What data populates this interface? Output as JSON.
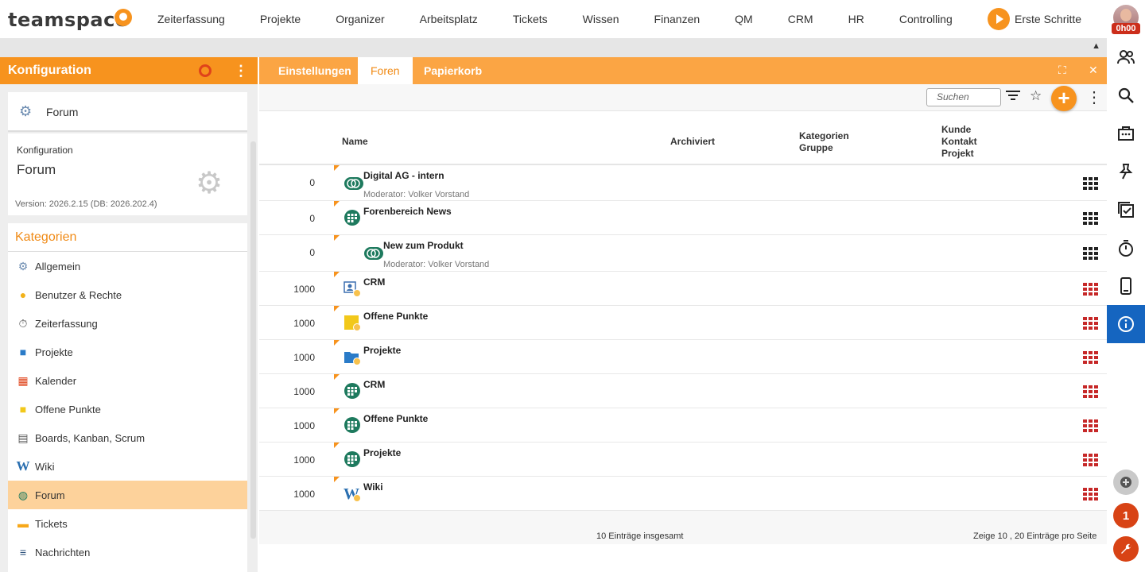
{
  "app": {
    "logo_text": "teamspace",
    "nav": [
      "Zeiterfassung",
      "Projekte",
      "Organizer",
      "Arbeitsplatz",
      "Tickets",
      "Wissen",
      "Finanzen",
      "QM",
      "CRM",
      "HR",
      "Controlling"
    ],
    "erste_schritte": "Erste Schritte",
    "time_badge": "0h00",
    "collapse_glyph": "▲"
  },
  "left": {
    "header_title": "Konfiguration",
    "menu_glyph": "⋮",
    "forum_card_label": "Forum",
    "info_small": "Konfiguration",
    "info_big": "Forum",
    "version": "Version: 2026.2.15 (DB: 2026.202.4)",
    "categories_title": "Kategorien",
    "categories": [
      {
        "label": "Allgemein",
        "icon": "⚙",
        "color": "#6b8bb0"
      },
      {
        "label": "Benutzer & Rechte",
        "icon": "●",
        "color": "#f2b21a"
      },
      {
        "label": "Zeiterfassung",
        "icon": "⏱",
        "color": "#555555"
      },
      {
        "label": "Projekte",
        "icon": "■",
        "color": "#2a7bc8"
      },
      {
        "label": "Kalender",
        "icon": "▦",
        "color": "#e0431a"
      },
      {
        "label": "Offene Punkte",
        "icon": "■",
        "color": "#f2c81a"
      },
      {
        "label": "Boards, Kanban, Scrum",
        "icon": "▤",
        "color": "#555555"
      },
      {
        "label": "Wiki",
        "icon": "W",
        "color": "#2a6fb0"
      },
      {
        "label": "Forum",
        "icon": "◍",
        "color": "#1e7a5e"
      },
      {
        "label": "Tickets",
        "icon": "▬",
        "color": "#f7a81a"
      },
      {
        "label": "Nachrichten",
        "icon": "≡",
        "color": "#2a4f7a"
      }
    ],
    "selected_category": "Forum"
  },
  "main": {
    "tabs": [
      "Einstellungen",
      "Foren",
      "Papierkorb"
    ],
    "active_tab": "Foren",
    "search_placeholder": "Suchen",
    "columns": {
      "name": "Name",
      "archiviert": "Archiviert",
      "kategorien": "Kategorien",
      "gruppe": "Gruppe",
      "kunde": "Kunde",
      "kontakt": "Kontakt",
      "projekt": "Projekt"
    },
    "rows": [
      {
        "num": "0",
        "name": "Digital AG - intern",
        "sub": "Moderator: Volker Vorstand",
        "icon": "chat",
        "indent": false,
        "grid": "black"
      },
      {
        "num": "0",
        "name": "Forenbereich News",
        "sub": "",
        "icon": "forum",
        "indent": false,
        "grid": "black"
      },
      {
        "num": "0",
        "name": "New zum Produkt",
        "sub": "Moderator: Volker Vorstand",
        "icon": "chat",
        "indent": true,
        "grid": "black"
      },
      {
        "num": "1000",
        "name": "CRM",
        "sub": "",
        "icon": "crm",
        "indent": false,
        "grid": "red"
      },
      {
        "num": "1000",
        "name": "Offene Punkte",
        "sub": "",
        "icon": "note",
        "indent": false,
        "grid": "red"
      },
      {
        "num": "1000",
        "name": "Projekte",
        "sub": "",
        "icon": "folder",
        "indent": false,
        "grid": "red"
      },
      {
        "num": "1000",
        "name": "CRM",
        "sub": "",
        "icon": "forum",
        "indent": false,
        "grid": "red"
      },
      {
        "num": "1000",
        "name": "Offene Punkte",
        "sub": "",
        "icon": "forum",
        "indent": false,
        "grid": "red"
      },
      {
        "num": "1000",
        "name": "Projekte",
        "sub": "",
        "icon": "forum",
        "indent": false,
        "grid": "red"
      },
      {
        "num": "1000",
        "name": "Wiki",
        "sub": "",
        "icon": "wiki",
        "indent": false,
        "grid": "red"
      }
    ],
    "footer_total": "10 Einträge insgesamt",
    "footer_pager": "Zeige  10 ,  20  Einträge pro Seite"
  },
  "rail": {
    "notification_count": "1"
  },
  "colors": {
    "accent": "#f7931e",
    "tab_bar": "#fba544",
    "selected": "#fdd29b",
    "rail_active": "#1565c0",
    "badge": "#cc2e1b"
  }
}
